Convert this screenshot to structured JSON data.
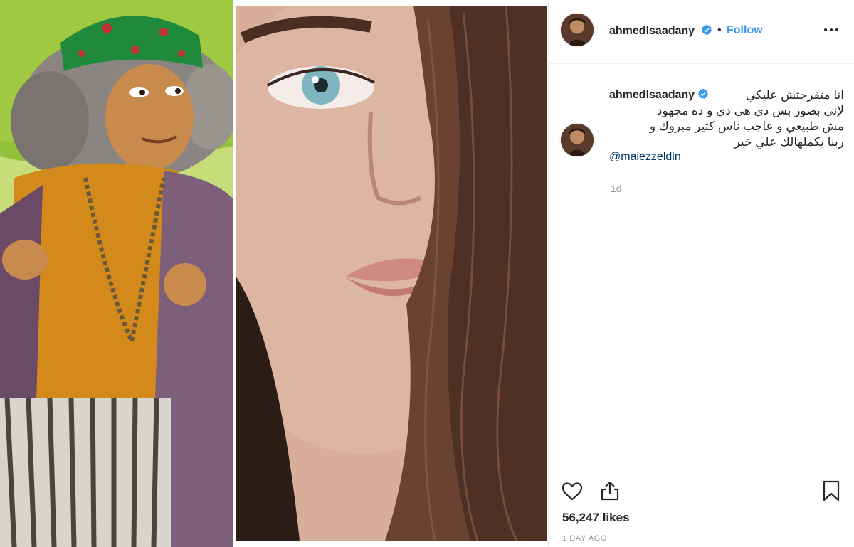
{
  "post": {
    "author": {
      "username": "ahmedlsaadany",
      "verified_icon": "verified-badge-icon",
      "avatar_icon": "profile-avatar"
    },
    "header": {
      "separator": "•",
      "follow_label": "Follow",
      "more_icon": "more-options-icon"
    },
    "caption": {
      "text": "انا متفرجتش عليكي\nلإني بصور بس دي هي دي و ده مجهود\nمش طبيعي و عاجب ناس كتير مبروك و\nربنا يكملهالك علي خير",
      "mention": "@maiezzeldin",
      "relative_time": "1d"
    },
    "actions": {
      "like_icon": "heart-icon",
      "share_icon": "share-icon",
      "save_icon": "bookmark-icon"
    },
    "likes": "56,247 likes",
    "date": "1 DAY AGO"
  },
  "colors": {
    "link_blue": "#3897f0",
    "mention_blue": "#003569",
    "muted_gray": "#999999",
    "text": "#262626",
    "verified_blue": "#3897f0"
  }
}
